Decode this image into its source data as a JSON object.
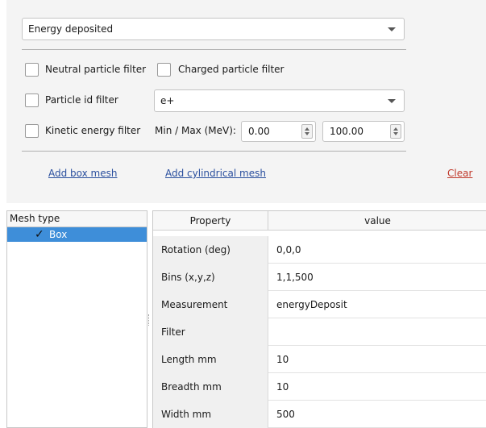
{
  "measurement_combo": {
    "selected": "Energy deposited"
  },
  "filters": {
    "neutral_label": "Neutral particle filter",
    "charged_label": "Charged particle filter",
    "particle_id_label": "Particle id filter",
    "particle_id_value": "e+",
    "kinetic_label": "Kinetic energy filter",
    "minmax_label": "Min / Max (MeV):",
    "min_value": "0.00",
    "max_value": "100.00"
  },
  "actions": {
    "add_box": "Add box mesh",
    "add_cyl": "Add cylindrical mesh",
    "clear": "Clear"
  },
  "mesh_list": {
    "header": "Mesh type",
    "items": [
      {
        "label": "Box",
        "checked": true
      }
    ]
  },
  "properties": {
    "header_property": "Property",
    "header_value": "value",
    "rows": [
      {
        "key": "Rotation  (deg)",
        "value": "0,0,0"
      },
      {
        "key": "Bins (x,y,z)",
        "value": "1,1,500"
      },
      {
        "key": "Measurement",
        "value": "energyDeposit"
      },
      {
        "key": "Filter",
        "value": ""
      },
      {
        "key": "Length mm",
        "value": "10"
      },
      {
        "key": "Breadth mm",
        "value": "10"
      },
      {
        "key": "Width mm",
        "value": "500"
      }
    ]
  },
  "colors": {
    "selection": "#3e8ed9",
    "link": "#2a4f9e",
    "clear": "#c0392b"
  }
}
